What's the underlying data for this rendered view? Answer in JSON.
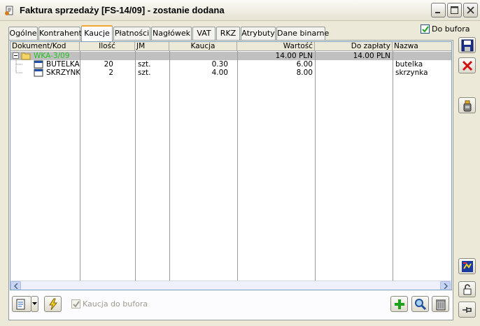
{
  "window": {
    "title": "Faktura sprzedaży [FS-14/09]  - zostanie dodana",
    "minimize_icon": "minimize-icon",
    "maximize_icon": "maximize-icon",
    "close_icon": "close-icon"
  },
  "tabs": [
    {
      "label": "Ogólne",
      "active": false
    },
    {
      "label": "Kontrahent",
      "active": false
    },
    {
      "label": "Kaucje",
      "active": true
    },
    {
      "label": "Płatności",
      "active": false
    },
    {
      "label": "Nagłówek",
      "active": false
    },
    {
      "label": "VAT",
      "active": false
    },
    {
      "label": "RKZ",
      "active": false
    },
    {
      "label": "Atrybuty",
      "active": false
    },
    {
      "label": "Dane binarne",
      "active": false
    }
  ],
  "do_bufora": {
    "label": "Do bufora",
    "checked": true
  },
  "grid": {
    "columns": [
      "Dokument/Kod",
      "Ilość",
      "JM",
      "Kaucja",
      "Wartość",
      "Do zapłaty",
      "Nazwa"
    ],
    "rows": [
      {
        "kod": "WKA-3/09",
        "ilosc": "",
        "jm": "",
        "kaucja": "",
        "wartosc": "14.00 PLN",
        "do_zaplaty": "14.00 PLN",
        "nazwa": "",
        "group": true
      },
      {
        "kod": "BUTELKA",
        "ilosc": "20",
        "jm": "szt.",
        "kaucja": "0.30",
        "wartosc": "6.00",
        "do_zaplaty": "",
        "nazwa": "butelka"
      },
      {
        "kod": "SKRZYNKA",
        "ilosc": "2",
        "jm": "szt.",
        "kaucja": "4.00",
        "wartosc": "8.00",
        "do_zaplaty": "",
        "nazwa": "skrzynka"
      }
    ]
  },
  "kaucja_do_bufora": {
    "label": "Kaucja do bufora",
    "checked": true,
    "enabled": false
  },
  "colors": {
    "accent": "#f0a830",
    "selected_row": "#c0c0c0",
    "group_text": "#22c022"
  },
  "icons": {
    "save": "save-icon",
    "cancel": "cancel-icon",
    "tool_right": "jar-icon",
    "refresh": "recalc-icon",
    "lock": "lock-icon",
    "pin": "pin-icon",
    "document": "document-icon",
    "lightning": "lightning-icon",
    "add": "add-icon",
    "search": "search-icon",
    "delete": "trash-icon"
  }
}
